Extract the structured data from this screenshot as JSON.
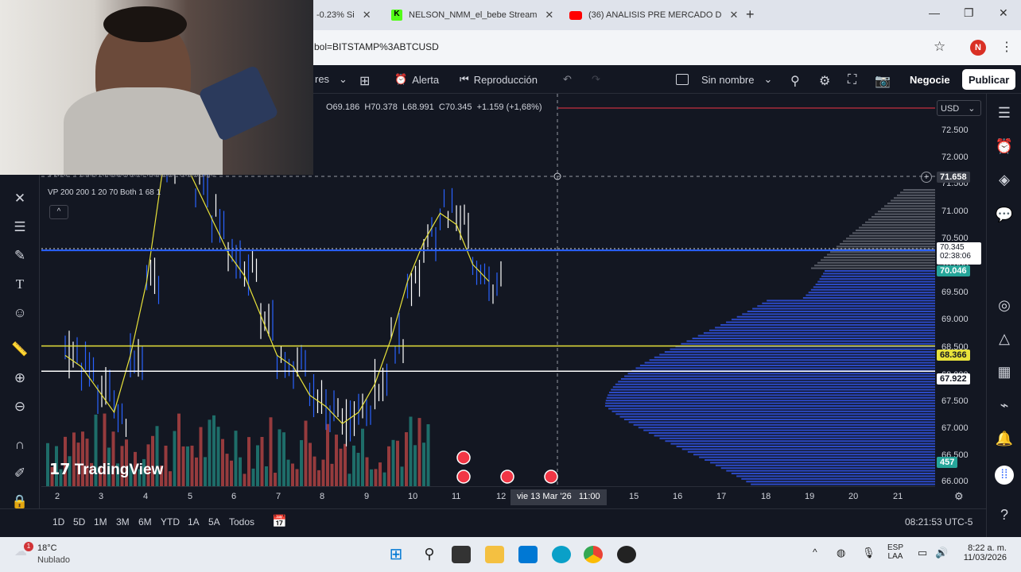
{
  "browser": {
    "tabs": [
      {
        "label": "-0.23% Si"
      },
      {
        "label": "NELSON_NMM_el_bebe Stream"
      },
      {
        "label": "(36) ANALISIS PRE MERCADO D"
      }
    ],
    "url": "bol=BITSTAMP%3ABTCUSD",
    "profile_initial": "N"
  },
  "tv_toolbar": {
    "indicators_partial": "res",
    "alert": "Alerta",
    "replay": "Reproducción",
    "layout_name": "Sin nombre",
    "trade_button": "Negocie",
    "publish_button": "Publicar"
  },
  "legend": {
    "ohlc": "O69.186  H70.378  L68.991  C70.345  +1.159 (+1,68%)",
    "indicator1": "VWAP + EMA Retracement Indicator SwiftEdge",
    "indicator2": "VP 200 200 1 20 70 Both 1 68 1"
  },
  "price_axis": {
    "currency": "USD",
    "ticks": [
      "72.500",
      "72.000",
      "71.500",
      "71.000",
      "70.500",
      "70.000",
      "69.500",
      "69.000",
      "68.500",
      "68.000",
      "67.500",
      "67.000",
      "66.500",
      "66.000"
    ],
    "crosshair_price": "71.658",
    "last_price": "70.345",
    "countdown": "02:38:06",
    "line_blue": "70.046",
    "line_yellow": "68.366",
    "line_white": "67.922",
    "volume_badge": "457"
  },
  "time_axis": {
    "ticks": [
      "2",
      "3",
      "4",
      "5",
      "6",
      "7",
      "8",
      "9",
      "10",
      "11",
      "12",
      "15",
      "16",
      "17",
      "18",
      "19",
      "20",
      "21"
    ],
    "crosshair_label": "vie 13 Mar '26   11:00"
  },
  "bottom_bar": {
    "ranges": [
      "1D",
      "5D",
      "1M",
      "3M",
      "6M",
      "YTD",
      "1A",
      "5A",
      "Todos"
    ],
    "clock": "08:21:53 UTC-5"
  },
  "watermark": "TradingView",
  "taskbar": {
    "weather_temp": "18°C",
    "weather_desc": "Nublado",
    "lang": "ESP",
    "lang2": "LAA",
    "time": "8:22 a. m.",
    "date": "11/03/2026",
    "notif_count": "1"
  },
  "chart_data": {
    "type": "candlestick",
    "title": "BITSTAMP:BTCUSD",
    "ylim": [
      65.9,
      72.8
    ],
    "horizontal_levels": [
      {
        "price": 70.046,
        "color": "#2962ff"
      },
      {
        "price": 68.366,
        "color": "#e8e23a"
      },
      {
        "price": 67.922,
        "color": "#ffffff"
      }
    ]
  },
  "colors": {
    "accent": "#2962ff",
    "up": "#26a69a",
    "down": "#ef5350",
    "yellow": "#e8e23a"
  }
}
